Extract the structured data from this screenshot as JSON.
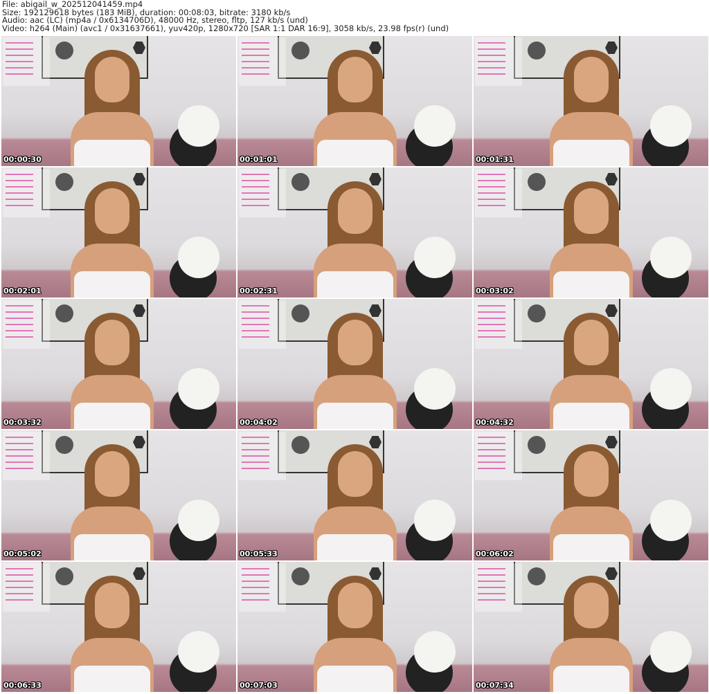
{
  "header": {
    "file": "File: abigail_w_202512041459.mp4",
    "size": "Size: 192129618 bytes (183 MiB), duration: 00:08:03, bitrate: 3180 kb/s",
    "audio": "Audio: aac (LC) (mp4a / 0x6134706D), 48000 Hz, stereo, fltp, 127 kb/s (und)",
    "video": "Video: h264 (Main) (avc1 / 0x31637661), yuv420p, 1280x720 [SAR 1:1 DAR 16:9], 3058 kb/s, 23.98 fps(r) (und)"
  },
  "thumbnails": [
    {
      "timestamp": "00:00:30"
    },
    {
      "timestamp": "00:01:01"
    },
    {
      "timestamp": "00:01:31"
    },
    {
      "timestamp": "00:02:01"
    },
    {
      "timestamp": "00:02:31"
    },
    {
      "timestamp": "00:03:02"
    },
    {
      "timestamp": "00:03:32"
    },
    {
      "timestamp": "00:04:02"
    },
    {
      "timestamp": "00:04:32"
    },
    {
      "timestamp": "00:05:02"
    },
    {
      "timestamp": "00:05:33"
    },
    {
      "timestamp": "00:06:02"
    },
    {
      "timestamp": "00:06:33"
    },
    {
      "timestamp": "00:07:03"
    },
    {
      "timestamp": "00:07:34"
    }
  ]
}
